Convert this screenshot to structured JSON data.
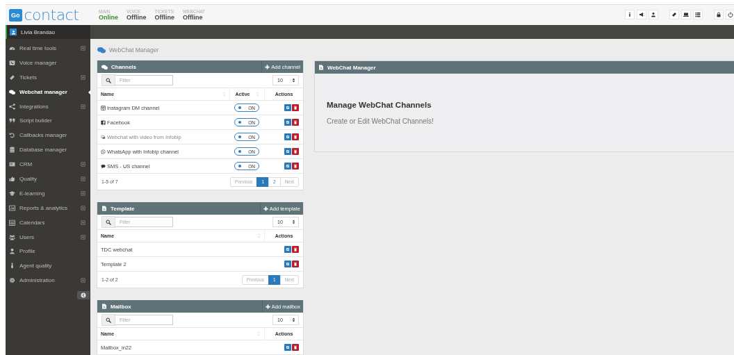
{
  "header": {
    "logo": {
      "badge": "Go",
      "text": "contact"
    },
    "statuses": [
      {
        "label": "MAIN",
        "value": "Online",
        "online": true
      },
      {
        "label": "VOICE",
        "value": "Offline",
        "online": false
      },
      {
        "label": "TICKETS",
        "value": "Offline",
        "online": false
      },
      {
        "label": "WEBCHAT",
        "value": "Offline",
        "online": false
      }
    ]
  },
  "user": {
    "name": "Livia Brandao"
  },
  "sidebar": {
    "items": [
      {
        "label": "Real time tools",
        "kind": "gauge",
        "expandable": true,
        "selected": false
      },
      {
        "label": "Voice manager",
        "kind": "phone",
        "expandable": false,
        "selected": false
      },
      {
        "label": "Tickets",
        "kind": "ticket",
        "expandable": true,
        "selected": false
      },
      {
        "label": "Webchat manager",
        "kind": "chat",
        "expandable": false,
        "selected": true
      },
      {
        "label": "Integrations",
        "kind": "share",
        "expandable": true,
        "selected": false
      },
      {
        "label": "Script builder",
        "kind": "quote",
        "expandable": false,
        "selected": false
      },
      {
        "label": "Callbacks manager",
        "kind": "undo",
        "expandable": false,
        "selected": false
      },
      {
        "label": "Database manager",
        "kind": "database",
        "expandable": false,
        "selected": false
      },
      {
        "label": "CRM",
        "kind": "card",
        "expandable": true,
        "selected": false
      },
      {
        "label": "Quality",
        "kind": "thumb",
        "expandable": true,
        "selected": false
      },
      {
        "label": "E-learning",
        "kind": "cap",
        "expandable": true,
        "selected": false
      },
      {
        "label": "Reports & analytics",
        "kind": "chart",
        "expandable": true,
        "selected": false
      },
      {
        "label": "Calendars",
        "kind": "calendar",
        "expandable": true,
        "selected": false
      },
      {
        "label": "Users",
        "kind": "users",
        "expandable": true,
        "selected": false
      },
      {
        "label": "Profile",
        "kind": "user",
        "expandable": false,
        "selected": false
      },
      {
        "label": "Agent quality",
        "kind": "tie",
        "expandable": false,
        "selected": false
      },
      {
        "label": "Administration",
        "kind": "gear",
        "expandable": true,
        "selected": false
      }
    ]
  },
  "breadcrumb": "WebChat Manager",
  "panels": [
    {
      "title": "Channels",
      "kind": "channels",
      "add_button": "Add channel",
      "filter": {
        "placeholder": "Filter"
      },
      "page_size": "10",
      "columns": [
        {
          "label": "Name",
          "sortable": true
        },
        {
          "label": "Active",
          "sortable": true
        },
        {
          "label": "Actions",
          "sortable": false
        }
      ],
      "rows": [
        {
          "name": "Instagram DM channel",
          "kind": "instagram",
          "toggle": {
            "label": "ON",
            "on": true
          }
        },
        {
          "name": "Facebook",
          "kind": "facebook",
          "toggle": {
            "label": "ON",
            "on": true
          }
        },
        {
          "name": "Webchat with video from Infobip",
          "kind": "webchat",
          "toggle": {
            "label": "ON",
            "on": true
          }
        },
        {
          "name": "WhatsApp with Infobip channel",
          "kind": "whatsapp",
          "toggle": {
            "label": "ON",
            "on": true
          }
        },
        {
          "name": "SMS - US channel",
          "kind": "sms",
          "toggle": {
            "label": "ON",
            "on": true
          }
        }
      ],
      "summary": "1-5 of 7",
      "pagination": [
        {
          "label": "Previous",
          "selected": false,
          "disabled": true
        },
        {
          "label": "1",
          "selected": true,
          "disabled": false
        },
        {
          "label": "2",
          "selected": false,
          "disabled": false
        },
        {
          "label": "Next",
          "selected": false,
          "disabled": true
        }
      ]
    },
    {
      "title": "Template",
      "kind": "document",
      "add_button": "Add template",
      "filter": {
        "placeholder": "Filter"
      },
      "page_size": "10",
      "columns": [
        {
          "label": "Name",
          "sortable": true
        },
        {
          "label": "Actions",
          "sortable": false
        }
      ],
      "rows": [
        {
          "name": "TDC webchat"
        },
        {
          "name": "Template 2"
        }
      ],
      "summary": "1-2 of 2",
      "pagination": [
        {
          "label": "Previous",
          "selected": false,
          "disabled": true
        },
        {
          "label": "1",
          "selected": true,
          "disabled": false
        },
        {
          "label": "Next",
          "selected": false,
          "disabled": true
        }
      ]
    },
    {
      "title": "Mailbox",
      "kind": "document",
      "add_button": "Add mailbox",
      "filter": {
        "placeholder": "Filter"
      },
      "page_size": "10",
      "columns": [
        {
          "label": "Name",
          "sortable": true
        },
        {
          "label": "Actions",
          "sortable": false
        }
      ],
      "rows": [
        {
          "name": "Mailbox_in22"
        }
      ]
    }
  ],
  "info_panel": {
    "title": "WebChat Manager",
    "heading": "Manage WebChat Channels",
    "text": "Create or Edit WebChat Channels!"
  }
}
